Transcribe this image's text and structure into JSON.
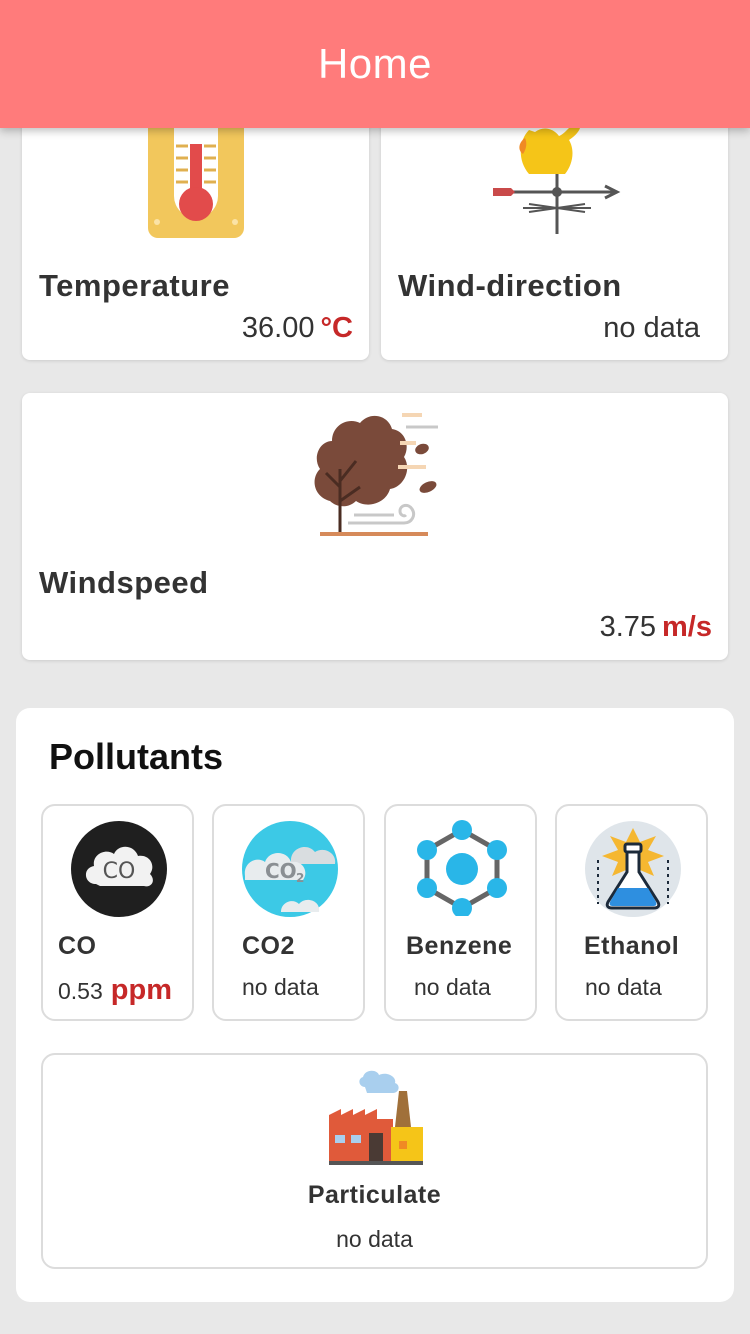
{
  "appbar": {
    "title": "Home"
  },
  "weather": {
    "temperature": {
      "label": "Temperature",
      "value": "36.00",
      "unit": "°C",
      "icon": "thermometer-icon"
    },
    "wind_direction": {
      "label": "Wind-direction",
      "value": "no data",
      "icon": "weathervane-icon"
    },
    "windspeed": {
      "label": "Windspeed",
      "value": "3.75",
      "unit": "m/s",
      "icon": "windy-tree-icon"
    }
  },
  "pollutants": {
    "heading": "Pollutants",
    "items": [
      {
        "label": "CO",
        "value": "0.53",
        "unit": "ppm",
        "icon": "co-cloud-icon"
      },
      {
        "label": "CO2",
        "value": "no data",
        "icon": "co2-cloud-icon"
      },
      {
        "label": "Benzene",
        "value": "no data",
        "icon": "benzene-molecule-icon"
      },
      {
        "label": "Ethanol",
        "value": "no data",
        "icon": "flask-icon"
      }
    ],
    "particulate": {
      "label": "Particulate",
      "value": "no data",
      "icon": "factory-icon"
    }
  },
  "colors": {
    "appbar": "#ff7b7b",
    "accent_unit": "#c62828",
    "background": "#e8e8e8"
  }
}
